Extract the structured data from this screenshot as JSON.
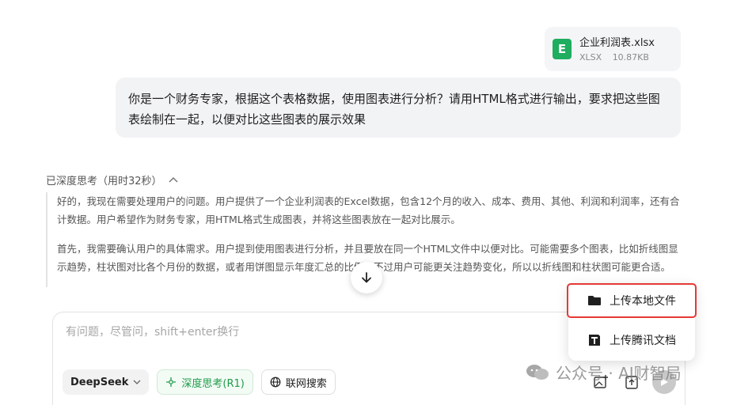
{
  "file": {
    "name": "企业利润表.xlsx",
    "type": "XLSX",
    "size": "10.87KB",
    "icon_letter": "E"
  },
  "user_message": "你是一个财务专家，根据这个表格数据，使用图表进行分析？请用HTML格式进行输出，要求把这些图表绘制在一起，以便对比这些图表的展示效果",
  "thinking": {
    "header": "已深度思考（用时32秒）",
    "paragraphs": [
      "好的，我现在需要处理用户的问题。用户提供了一个企业利润表的Excel数据，包含12个月的收入、成本、费用、其他、利润和利润率，还有合计数据。用户希望作为财务专家，用HTML格式生成图表，并将这些图表放在一起对比展示。",
      "首先，我需要确认用户的具体需求。用户提到使用图表进行分析，并且要放在同一个HTML文件中以便对比。可能需要多个图表，比如折线图显示趋势，柱状图对比各个月份的数据，或者用饼图显示年度汇总的比例。不过用户可能更关注趋势变化，所以以折线图和柱状图可能更合适。"
    ]
  },
  "composer": {
    "placeholder": "有问题，尽管问，shift+enter换行",
    "model_label": "DeepSeek",
    "deep_think_label": "深度思考(R1)",
    "web_search_label": "联网搜索"
  },
  "upload_menu": {
    "local_label": "上传本地文件",
    "tencent_label": "上传腾讯文档"
  },
  "watermark": "公众号 · AI财智局",
  "colors": {
    "accent_green": "#1f9b49",
    "excel_green": "#1fad5f",
    "highlight_red": "#e53935"
  }
}
